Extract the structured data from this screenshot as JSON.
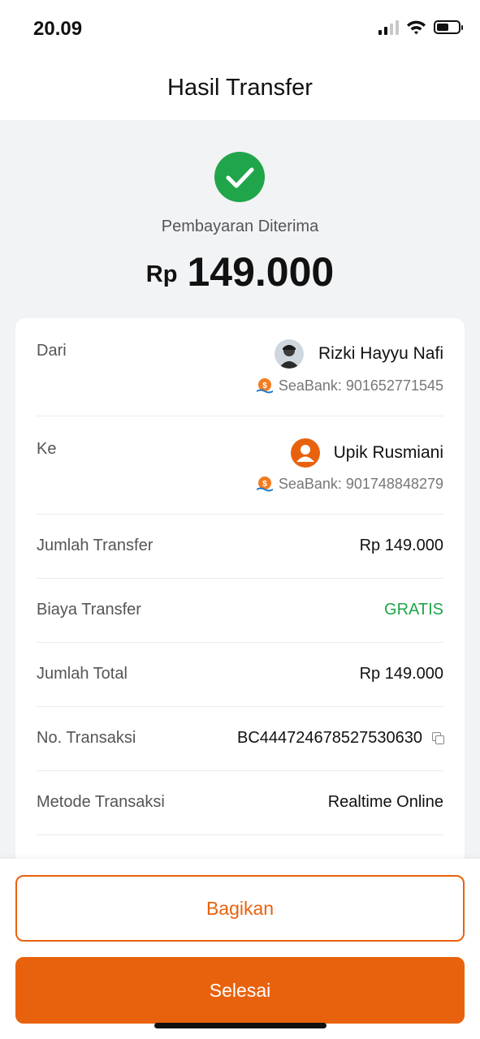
{
  "status_bar": {
    "time": "20.09",
    "battery_level": 0.55
  },
  "header": {
    "title": "Hasil Transfer"
  },
  "result": {
    "status": "Pembayaran Diterima",
    "currency": "Rp",
    "amount": "149.000"
  },
  "sender": {
    "label": "Dari",
    "name": "Rizki Hayyu Nafi",
    "account": "SeaBank: 901652771545"
  },
  "recipient": {
    "label": "Ke",
    "name": "Upik Rusmiani",
    "account": "SeaBank: 901748848279"
  },
  "details": {
    "transfer_amount": {
      "label": "Jumlah Transfer",
      "value": "Rp 149.000"
    },
    "transfer_fee": {
      "label": "Biaya Transfer",
      "value": "GRATIS"
    },
    "total_amount": {
      "label": "Jumlah Total",
      "value": "Rp 149.000"
    },
    "transaction_no": {
      "label": "No. Transaksi",
      "value": "BC444724678527530630"
    },
    "method": {
      "label": "Metode Transaksi",
      "value": "Realtime Online"
    }
  },
  "actions": {
    "share_label": "Bagikan",
    "done_label": "Selesai"
  },
  "colors": {
    "accent": "#e8620d",
    "success": "#20a54a"
  },
  "icons": [
    "signal-icon",
    "wifi-icon",
    "battery-icon",
    "check-circle-icon",
    "avatar-photo",
    "user-avatar-icon",
    "seabank-logo-icon",
    "copy-icon"
  ]
}
